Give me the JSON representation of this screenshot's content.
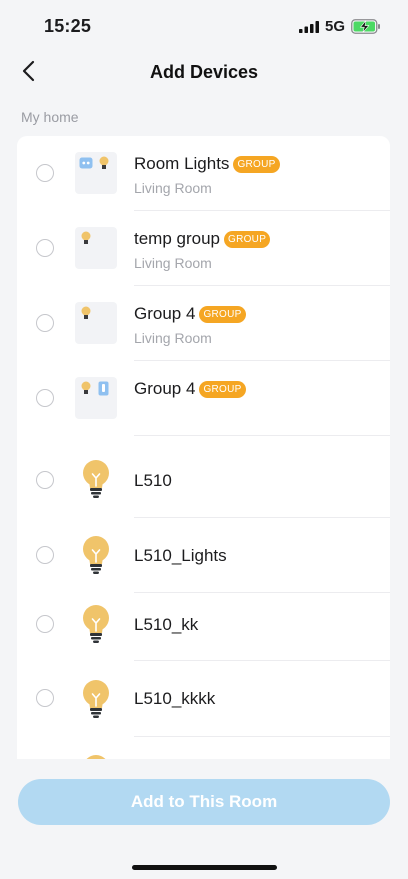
{
  "status": {
    "time": "15:25",
    "network": "5G"
  },
  "header": {
    "title": "Add Devices"
  },
  "section": {
    "label": "My home"
  },
  "rows": [
    {
      "name": "Room Lights",
      "badge": "GROUP",
      "room": "Living Room",
      "icon": "group-plug-bulb-icon"
    },
    {
      "name": "temp group",
      "badge": "GROUP",
      "room": "Living Room",
      "icon": "group-bulb-icon"
    },
    {
      "name": "Group 4",
      "badge": "GROUP",
      "room": "Living Room",
      "icon": "group-bulb-icon"
    },
    {
      "name": "Group 4",
      "badge": "GROUP",
      "room": "",
      "icon": "group-bulb-switch-icon"
    },
    {
      "name": "L510",
      "icon": "bulb-icon"
    },
    {
      "name": "L510_Lights",
      "icon": "bulb-icon"
    },
    {
      "name": "L510_kk",
      "icon": "bulb-icon"
    },
    {
      "name": "L510_kkkk",
      "icon": "bulb-icon"
    }
  ],
  "footer": {
    "button_label": "Add to This Room"
  },
  "colors": {
    "accent": "#f5a623",
    "button": "#b2d9f2",
    "bulb": "#f0c46a",
    "plug": "#8fc0f0"
  }
}
